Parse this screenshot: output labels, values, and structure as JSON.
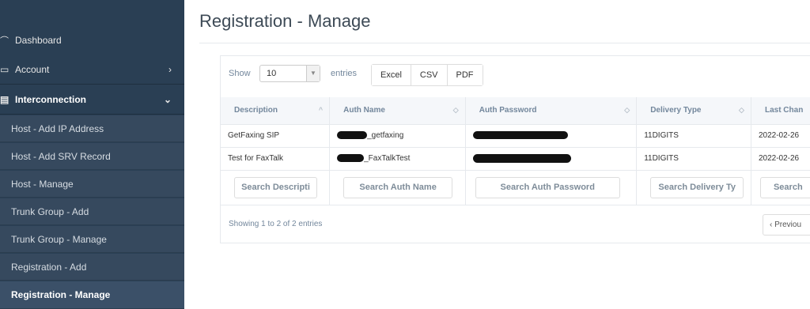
{
  "sidebar": {
    "dashboard": "Dashboard",
    "account": "Account",
    "interconnection": "Interconnection",
    "sub_items": [
      "Host - Add IP Address",
      "Host - Add SRV Record",
      "Host - Manage",
      "Trunk Group - Add",
      "Trunk Group - Manage",
      "Registration - Add",
      "Registration - Manage"
    ],
    "active_item": "Registration - Manage"
  },
  "main": {
    "title": "Registration - Manage",
    "show_label": "Show",
    "page_length": "10",
    "entries_label": "entries",
    "buttons": [
      "Excel",
      "CSV",
      "PDF"
    ],
    "columns": [
      "Description",
      "Auth Name",
      "Auth Password",
      "Delivery Type",
      "Last Chan"
    ],
    "rows": [
      {
        "description": "GetFaxing SIP",
        "auth_name_suffix": "_getfaxing",
        "delivery_type": "11DIGITS",
        "last_changed": "2022-02-26"
      },
      {
        "description": "Test for FaxTalk",
        "auth_name_suffix": "_FaxTalkTest",
        "delivery_type": "11DIGITS",
        "last_changed": "2022-02-26"
      }
    ],
    "search_placeholders": [
      "Search Descripti",
      "Search Auth Name",
      "Search Auth Password",
      "Search Delivery Ty",
      "Search"
    ],
    "info": "Showing 1 to 2 of 2 entries",
    "previous": "Previou"
  },
  "colors": {
    "sidebar": "#2a3f54",
    "title": "#3d4a56",
    "muted": "#73879c"
  }
}
